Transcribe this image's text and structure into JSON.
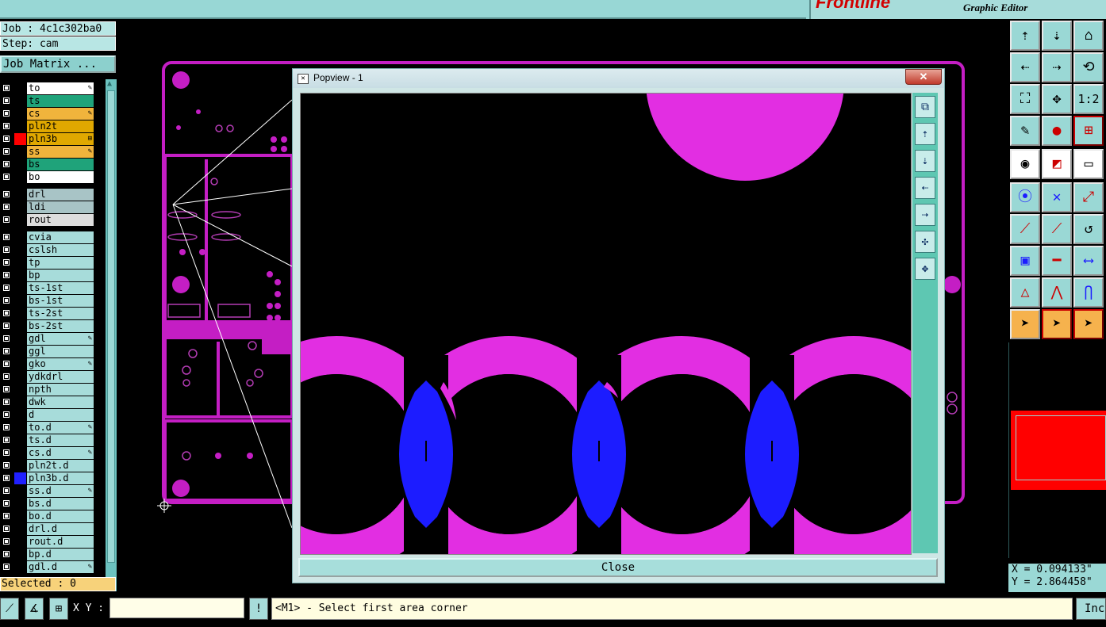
{
  "brand": {
    "logo": "Frontline",
    "subtitle": "Graphic Editor"
  },
  "job": {
    "job_label": "Job : 4c1c302ba0",
    "step_label": "Step: cam",
    "matrix_button": "Job Matrix ..."
  },
  "layers": [
    {
      "name": "to",
      "color": "#ffffff",
      "swatch": "#000000",
      "marker": "✎"
    },
    {
      "name": "ts",
      "color": "#1fa37a",
      "swatch": "#000000",
      "marker": ""
    },
    {
      "name": "cs",
      "color": "#f0b43c",
      "swatch": "#000000",
      "marker": "✎"
    },
    {
      "name": "pln2t",
      "color": "#e0a800",
      "swatch": "#000000",
      "marker": ""
    },
    {
      "name": "pln3b",
      "color": "#e0a800",
      "swatch": "#ff0000",
      "marker": "⊞"
    },
    {
      "name": "ss",
      "color": "#f0b43c",
      "swatch": "#000000",
      "marker": "✎"
    },
    {
      "name": "bs",
      "color": "#1fa37a",
      "swatch": "#000000",
      "marker": ""
    },
    {
      "name": "bo",
      "color": "#ffffff",
      "swatch": "#000000",
      "marker": ""
    },
    {
      "name": "drl",
      "color": "#a8c4c6",
      "swatch": "#000000",
      "marker": ""
    },
    {
      "name": "ldi",
      "color": "#a8c4c6",
      "swatch": "#000000",
      "marker": ""
    },
    {
      "name": "rout",
      "color": "#dddddd",
      "swatch": "#000000",
      "marker": ""
    },
    {
      "name": "cvia",
      "color": "#a7dcda",
      "swatch": "#000000",
      "marker": ""
    },
    {
      "name": "cslsh",
      "color": "#a7dcda",
      "swatch": "#000000",
      "marker": ""
    },
    {
      "name": "tp",
      "color": "#a7dcda",
      "swatch": "#000000",
      "marker": ""
    },
    {
      "name": "bp",
      "color": "#a7dcda",
      "swatch": "#000000",
      "marker": ""
    },
    {
      "name": "ts-1st",
      "color": "#a7dcda",
      "swatch": "#000000",
      "marker": ""
    },
    {
      "name": "bs-1st",
      "color": "#a7dcda",
      "swatch": "#000000",
      "marker": ""
    },
    {
      "name": "ts-2st",
      "color": "#a7dcda",
      "swatch": "#000000",
      "marker": ""
    },
    {
      "name": "bs-2st",
      "color": "#a7dcda",
      "swatch": "#000000",
      "marker": ""
    },
    {
      "name": "gdl",
      "color": "#a7dcda",
      "swatch": "#000000",
      "marker": "✎"
    },
    {
      "name": "ggl",
      "color": "#a7dcda",
      "swatch": "#000000",
      "marker": ""
    },
    {
      "name": "gko",
      "color": "#a7dcda",
      "swatch": "#000000",
      "marker": "✎"
    },
    {
      "name": "ydkdrl",
      "color": "#a7dcda",
      "swatch": "#000000",
      "marker": ""
    },
    {
      "name": "npth",
      "color": "#a7dcda",
      "swatch": "#000000",
      "marker": ""
    },
    {
      "name": "dwk",
      "color": "#a7dcda",
      "swatch": "#000000",
      "marker": ""
    },
    {
      "name": "d",
      "color": "#a7dcda",
      "swatch": "#000000",
      "marker": ""
    },
    {
      "name": "to.d",
      "color": "#a7dcda",
      "swatch": "#000000",
      "marker": "✎"
    },
    {
      "name": "ts.d",
      "color": "#a7dcda",
      "swatch": "#000000",
      "marker": ""
    },
    {
      "name": "cs.d",
      "color": "#a7dcda",
      "swatch": "#000000",
      "marker": "✎"
    },
    {
      "name": "pln2t.d",
      "color": "#a7dcda",
      "swatch": "#000000",
      "marker": ""
    },
    {
      "name": "pln3b.d",
      "color": "#a7dcda",
      "swatch": "#2020ff",
      "marker": ""
    },
    {
      "name": "ss.d",
      "color": "#a7dcda",
      "swatch": "#000000",
      "marker": "✎"
    },
    {
      "name": "bs.d",
      "color": "#a7dcda",
      "swatch": "#000000",
      "marker": ""
    },
    {
      "name": "bo.d",
      "color": "#a7dcda",
      "swatch": "#000000",
      "marker": ""
    },
    {
      "name": "drl.d",
      "color": "#a7dcda",
      "swatch": "#000000",
      "marker": ""
    },
    {
      "name": "rout.d",
      "color": "#a7dcda",
      "swatch": "#000000",
      "marker": ""
    },
    {
      "name": "bp.d",
      "color": "#a7dcda",
      "swatch": "#000000",
      "marker": ""
    },
    {
      "name": "gdl.d",
      "color": "#a7dcda",
      "swatch": "#000000",
      "marker": "✎"
    }
  ],
  "selected_label": "Selected : 0",
  "popview": {
    "title": "Popview - 1",
    "close_button": "Close",
    "close_x": "✕"
  },
  "colors": {
    "magenta": "#e22ee2",
    "blue": "#1c1cff",
    "board_outline": "#c41ec4"
  },
  "coords": {
    "x": "X = 0.094133\"",
    "y": "Y = 2.864458\""
  },
  "status": {
    "xy_label": "X Y :",
    "xy_value": "",
    "message": "<M1> - Select first area corner",
    "inc_button": "Inc"
  }
}
